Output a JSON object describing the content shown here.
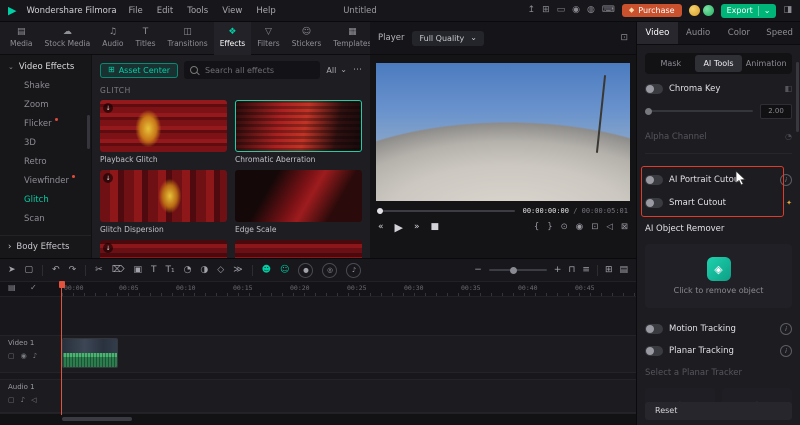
{
  "colors": {
    "accent": "#00cfa6",
    "purchase": "#c9512e",
    "export_green": "#00b578",
    "highlight_red": "#e03a28",
    "wave_green": "#2c7d4e"
  },
  "menubar": {
    "app_name": "Wondershare Filmora",
    "menus": [
      "File",
      "Edit",
      "Tools",
      "View",
      "Help"
    ],
    "project_title": "Untitled",
    "purchase_label": "Purchase",
    "export_label": "Export"
  },
  "media_toolbar": {
    "tabs": [
      {
        "label": "Media",
        "icon": "▤"
      },
      {
        "label": "Stock Media",
        "icon": "☁"
      },
      {
        "label": "Audio",
        "icon": "♫"
      },
      {
        "label": "Titles",
        "icon": "T"
      },
      {
        "label": "Transitions",
        "icon": "◫"
      },
      {
        "label": "Effects",
        "icon": "❖"
      },
      {
        "label": "Filters",
        "icon": "▽"
      },
      {
        "label": "Stickers",
        "icon": "☺"
      },
      {
        "label": "Templates",
        "icon": "▦"
      }
    ],
    "player_label": "Player",
    "quality": "Full Quality"
  },
  "sidebar": {
    "header": "Video Effects",
    "items": [
      "Shake",
      "Zoom",
      "Flicker",
      "3D",
      "Retro",
      "Viewfinder",
      "Glitch",
      "Scan"
    ],
    "footer": "Body Effects"
  },
  "effects_panel": {
    "asset_center": "Asset Center",
    "search_placeholder": "Search all effects",
    "filter_label": "All",
    "section_title": "GLITCH",
    "effects": [
      "Playback Glitch",
      "Chromatic Aberration",
      "Glitch Dispersion",
      "Edge Scale"
    ]
  },
  "preview": {
    "current_time": "00:00:00:00",
    "duration": "/ 00:00:05:01"
  },
  "right_panel": {
    "tabs": [
      "Video",
      "Audio",
      "Color",
      "Speed"
    ],
    "subtabs": [
      "Mask",
      "AI Tools",
      "Animation"
    ],
    "chroma_key_label": "Chroma Key",
    "chroma_value": "2.00",
    "alpha_channel_label": "Alpha Channel",
    "ai_portrait_label": "AI Portrait Cutout",
    "smart_cutout_label": "Smart Cutout",
    "object_remover_label": "AI Object Remover",
    "remover_hint": "Click to remove object",
    "motion_tracking_label": "Motion Tracking",
    "planar_tracking_label": "Planar Tracking",
    "select_tracker_label": "Select a Planar Tracker",
    "reset_label": "Reset"
  },
  "timeline": {
    "ruler": [
      "00:00",
      "00:05",
      "00:10",
      "00:15",
      "00:20",
      "00:25",
      "00:30",
      "00:35",
      "00:40",
      "00:45"
    ],
    "video_track": "Video 1",
    "audio_track": "Audio 1"
  },
  "icons": {
    "logo": "▶",
    "chevron_down": "⌄",
    "chevron_right": "›",
    "more": "⋯",
    "upload": "↥",
    "layout": "⊞",
    "monitor": "▭",
    "record": "◉",
    "bell": "◍",
    "keyboard": "⌨",
    "layout_toggle": "◨",
    "diamond": "◆",
    "expand": "⊡",
    "download": "↓",
    "play": "▶",
    "skip_back": "«",
    "skip_forward": "»",
    "stop": "■",
    "bracket_in": "{",
    "bracket_out": "}",
    "marker": "⊙",
    "snapshot": "◉",
    "crop_small": "⊡",
    "volume": "◁",
    "fullscreen": "⊠",
    "pointer": "➤",
    "select_box": "▢",
    "undo": "↶",
    "redo": "↷",
    "scissors": "✂",
    "delete": "⌦",
    "crop": "▣",
    "text": "T",
    "caption": "T₁",
    "speed": "◔",
    "mask": "◑",
    "keyframe": "◇",
    "more_tools": "≫",
    "person": "☻",
    "smiley": "☺",
    "circle_record": "●",
    "circle_mask": "◎",
    "circle_mic": "♪",
    "zoom_out": "−",
    "zoom_in": "+",
    "magnet": "⊓",
    "snap": "≡",
    "grid": "⊞",
    "list": "▤",
    "lock": "▢",
    "eye": "◉",
    "mute": "♪",
    "info": "i",
    "new_badge": "✦",
    "target": "⌖",
    "picker": "◧",
    "eyedropper": "◔",
    "film": "▤",
    "check": "✓",
    "remover": "◈"
  }
}
